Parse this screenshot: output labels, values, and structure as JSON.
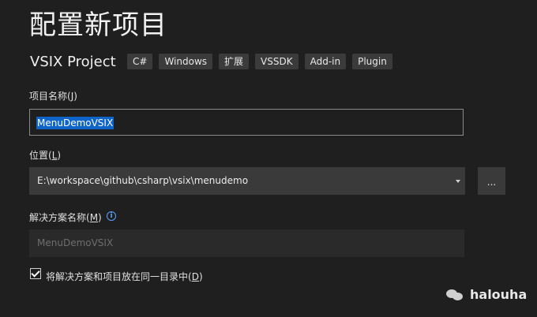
{
  "header": {
    "title": "配置新项目"
  },
  "project": {
    "name": "VSIX Project",
    "tags": [
      "C#",
      "Windows",
      "扩展",
      "VSSDK",
      "Add-in",
      "Plugin"
    ]
  },
  "fields": {
    "project_name_label": "项目名称(",
    "project_name_accel": "J",
    "project_name_label_end": ")",
    "project_name_value": "MenuDemoVSIX",
    "location_label": "位置(",
    "location_accel": "L",
    "location_label_end": ")",
    "location_value": "E:\\workspace\\github\\csharp\\vsix\\menudemo",
    "browse_label": "...",
    "solution_label": "解决方案名称(",
    "solution_accel": "M",
    "solution_label_end": ")",
    "solution_placeholder": "MenuDemoVSIX",
    "info_icon_glyph": "i",
    "same_dir_label": "将解决方案和项目放在同一目录中(",
    "same_dir_accel": "D",
    "same_dir_label_end": ")",
    "same_dir_checked": true
  },
  "watermark": {
    "icon": "wechat-icon",
    "text": "halouha"
  },
  "colors": {
    "background": "#1f1f1f",
    "selection": "#0e64c8",
    "info": "#5aa0ff"
  }
}
